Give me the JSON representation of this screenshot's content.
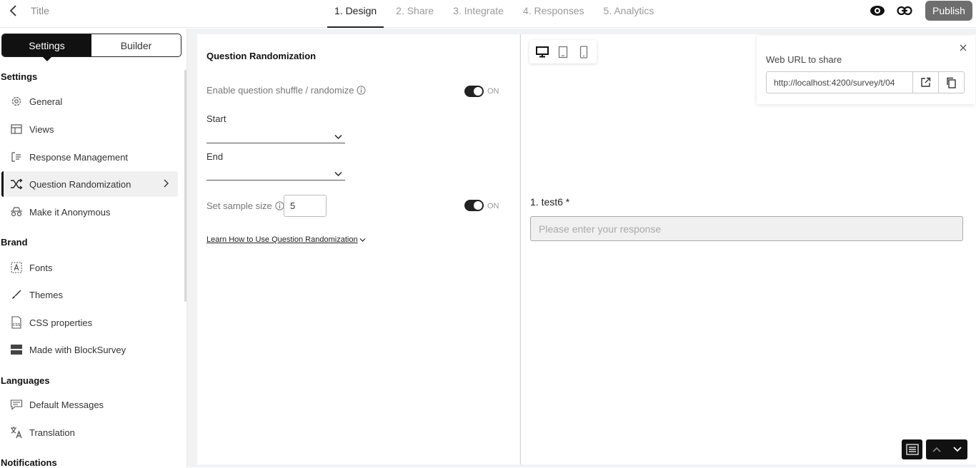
{
  "header": {
    "title": "Title",
    "steps": [
      "1. Design",
      "2. Share",
      "3. Integrate",
      "4. Responses",
      "5. Analytics"
    ],
    "publish_label": "Publish"
  },
  "sidebar": {
    "tabs": [
      "Settings",
      "Builder"
    ],
    "sections": {
      "settings": "Settings",
      "brand": "Brand",
      "languages": "Languages",
      "notifications": "Notifications"
    },
    "items": [
      {
        "label": "General",
        "icon": "gear-icon"
      },
      {
        "label": "Views",
        "icon": "table-icon"
      },
      {
        "label": "Response Management",
        "icon": "list-icon"
      },
      {
        "label": "Question Randomization",
        "icon": "shuffle-icon"
      },
      {
        "label": "Make it Anonymous",
        "icon": "incognito-icon"
      },
      {
        "label": "Fonts",
        "icon": "font-icon"
      },
      {
        "label": "Themes",
        "icon": "brush-icon"
      },
      {
        "label": "CSS properties",
        "icon": "css-file-icon"
      },
      {
        "label": "Made with BlockSurvey",
        "icon": "layout-icon"
      },
      {
        "label": "Default Messages",
        "icon": "message-icon"
      },
      {
        "label": "Translation",
        "icon": "translate-icon"
      }
    ]
  },
  "panel": {
    "title": "Question Randomization",
    "shuffle_label": "Enable question shuffle / randomize",
    "shuffle_state": "ON",
    "start_label": "Start",
    "end_label": "End",
    "sample_label": "Set sample size",
    "sample_value": "5",
    "sample_state": "ON",
    "learn_link": "Learn How to Use Question Randomization"
  },
  "preview": {
    "share_title": "Web URL to share",
    "share_url": "http://localhost:4200/survey/t/04",
    "question_label": "1. test6 *",
    "response_placeholder": "Please enter your response"
  },
  "colors": {
    "accent": "#111111",
    "publish_bg": "#6e6e6e",
    "canvas_bg": "#f1f2f4"
  }
}
